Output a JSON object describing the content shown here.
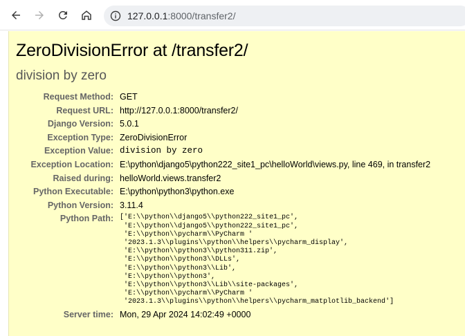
{
  "browser": {
    "url_host": "127.0.0.1",
    "url_rest": ":8000/transfer2/"
  },
  "error": {
    "title": "ZeroDivisionError at /transfer2/",
    "subtitle": "division by zero"
  },
  "meta": [
    {
      "label": "Request Method:",
      "value": "GET",
      "mono": false
    },
    {
      "label": "Request URL:",
      "value": "http://127.0.0.1:8000/transfer2/",
      "mono": false
    },
    {
      "label": "Django Version:",
      "value": "5.0.1",
      "mono": false
    },
    {
      "label": "Exception Type:",
      "value": "ZeroDivisionError",
      "mono": false
    },
    {
      "label": "Exception Value:",
      "value": "division by zero",
      "mono": true
    },
    {
      "label": "Exception Location:",
      "value": "E:\\python\\django5\\python222_site1_pc\\helloWorld\\views.py, line 469, in transfer2",
      "mono": false
    },
    {
      "label": "Raised during:",
      "value": "helloWorld.views.transfer2",
      "mono": false
    },
    {
      "label": "Python Executable:",
      "value": "E:\\python\\python3\\python.exe",
      "mono": false
    },
    {
      "label": "Python Version:",
      "value": "3.11.4",
      "mono": false
    }
  ],
  "python_path": {
    "label": "Python Path:",
    "lines": [
      "['E:\\\\python\\\\django5\\\\python222_site1_pc',",
      " 'E:\\\\python\\\\django5\\\\python222_site1_pc',",
      " 'E:\\\\python\\\\pycharm\\\\PyCharm '",
      " '2023.1.3\\\\plugins\\\\python\\\\helpers\\\\pycharm_display',",
      " 'E:\\\\python\\\\python3\\\\python311.zip',",
      " 'E:\\\\python\\\\python3\\\\DLLs',",
      " 'E:\\\\python\\\\python3\\\\Lib',",
      " 'E:\\\\python\\\\python3',",
      " 'E:\\\\python\\\\python3\\\\Lib\\\\site-packages',",
      " 'E:\\\\python\\\\pycharm\\\\PyCharm '",
      " '2023.1.3\\\\plugins\\\\python\\\\helpers\\\\pycharm_matplotlib_backend']"
    ]
  },
  "server_time": {
    "label": "Server time:",
    "value": "Mon, 29 Apr 2024 14:02:49 +0000"
  },
  "colors": {
    "summary_bg": "#ffffc8",
    "label_gray": "#666666"
  },
  "icons": {
    "back": "arrow-left-icon",
    "forward": "arrow-right-icon",
    "reload": "reload-icon",
    "home": "home-icon",
    "info": "info-icon"
  }
}
